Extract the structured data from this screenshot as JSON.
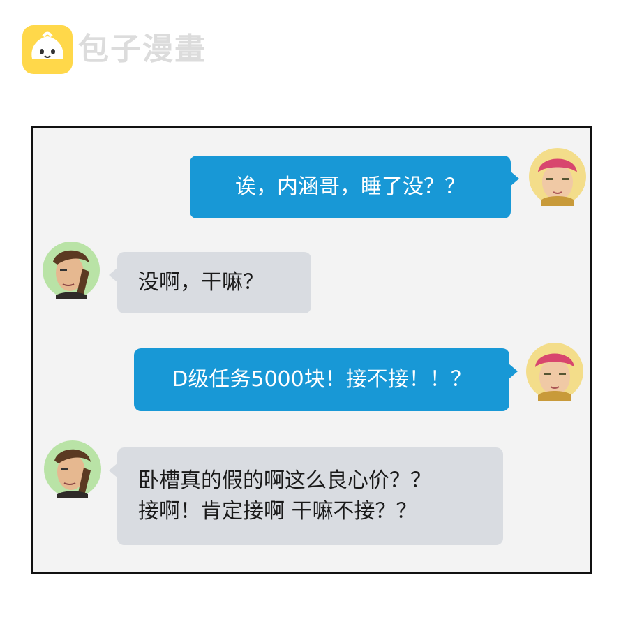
{
  "watermark": {
    "brand": "包子漫畫",
    "icon": "bun-logo-icon"
  },
  "chat": {
    "messages": [
      {
        "side": "right",
        "speaker_icon": "pink-hair-avatar-icon",
        "text": "诶，内涵哥，睡了没？？"
      },
      {
        "side": "left",
        "speaker_icon": "bearded-man-avatar-icon",
        "text": "没啊，干嘛？"
      },
      {
        "side": "right",
        "speaker_icon": "pink-hair-avatar-icon",
        "text": "D级任务5000块！接不接！！？"
      },
      {
        "side": "left",
        "speaker_icon": "bearded-man-avatar-icon",
        "text": "卧槽真的假的啊这么良心价？？\n接啊！肯定接啊 干嘛不接？？"
      }
    ]
  },
  "colors": {
    "right_bubble": "#1898d6",
    "left_bubble": "#d9dce1",
    "panel_bg": "#f3f3f3",
    "logo_yellow": "#ffd84a"
  }
}
